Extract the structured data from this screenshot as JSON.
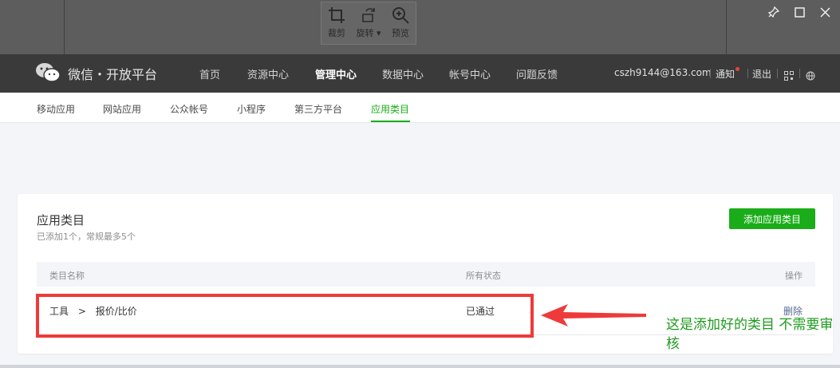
{
  "tool": {
    "buttons": [
      {
        "label": "裁剪",
        "icon": "crop-icon"
      },
      {
        "label": "旋转",
        "icon": "rotate-icon"
      },
      {
        "label": "预览",
        "icon": "zoom-icon"
      }
    ]
  },
  "header": {
    "brand": "微信・开放平台",
    "nav": [
      "首页",
      "资源中心",
      "管理中心",
      "数据中心",
      "帐号中心",
      "问题反馈"
    ],
    "active_nav": "管理中心",
    "account": "cszh9144@163.com",
    "notify": "通知",
    "logout": "退出"
  },
  "subnav": {
    "items": [
      "移动应用",
      "网站应用",
      "公众帐号",
      "小程序",
      "第三方平台",
      "应用类目"
    ],
    "active": "应用类目"
  },
  "card": {
    "title": "应用类目",
    "subtitle": "已添加1个，常规最多5个",
    "add_button": "添加应用类目",
    "columns": {
      "name": "类目名称",
      "status": "所有状态",
      "action": "操作"
    },
    "rows": [
      {
        "category": "工具",
        "separator": ">",
        "subcategory": "报价/比价",
        "status": "已通过",
        "action": "删除"
      }
    ]
  },
  "annotation": {
    "text": "这是添加好的类目 不需要审核",
    "color": "#1e9b1e",
    "box_color": "#ee3a3a"
  },
  "colors": {
    "accent": "#1aad19",
    "nav_bg": "#3a3a3a",
    "link": "#576b95"
  }
}
